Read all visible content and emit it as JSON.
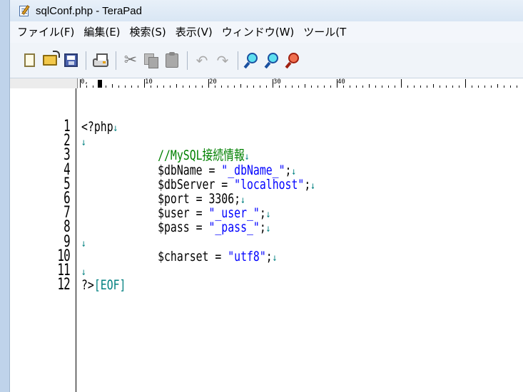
{
  "window": {
    "title": "sqlConf.php - TeraPad",
    "icon": "terapad-app-icon"
  },
  "menu": {
    "items": [
      "ファイル(F)",
      "編集(E)",
      "検索(S)",
      "表示(V)",
      "ウィンドウ(W)",
      "ツール(T"
    ]
  },
  "toolbar": {
    "icons": [
      "new-file-icon",
      "open-file-icon",
      "save-icon",
      "print-icon",
      "cut-icon",
      "copy-icon",
      "paste-icon",
      "undo-icon",
      "redo-icon",
      "find-icon",
      "find-prev-icon",
      "find-next-icon"
    ]
  },
  "ruler": {
    "labels": [
      "0,",
      "10",
      "20",
      "30",
      "40"
    ]
  },
  "editor": {
    "newline_mark": "↓",
    "lines": [
      {
        "no": "1",
        "indent": "",
        "parts": [
          {
            "t": "<?php",
            "c": "plain"
          }
        ],
        "nl": true
      },
      {
        "no": "2",
        "indent": "",
        "parts": [],
        "nl": true
      },
      {
        "no": "3",
        "indent": "            ",
        "parts": [
          {
            "t": "//MySQL接続情報",
            "c": "comment"
          }
        ],
        "nl": true
      },
      {
        "no": "4",
        "indent": "            ",
        "parts": [
          {
            "t": "$dbName = ",
            "c": "plain"
          },
          {
            "t": "\"_dbName_\"",
            "c": "string"
          },
          {
            "t": ";",
            "c": "plain"
          }
        ],
        "nl": true
      },
      {
        "no": "5",
        "indent": "            ",
        "parts": [
          {
            "t": "$dbServer = ",
            "c": "plain"
          },
          {
            "t": "\"localhost\"",
            "c": "string"
          },
          {
            "t": ";",
            "c": "plain"
          }
        ],
        "nl": true
      },
      {
        "no": "6",
        "indent": "            ",
        "parts": [
          {
            "t": "$port = 3306;",
            "c": "plain"
          }
        ],
        "nl": true
      },
      {
        "no": "7",
        "indent": "            ",
        "parts": [
          {
            "t": "$user = ",
            "c": "plain"
          },
          {
            "t": "\"_user_\"",
            "c": "string"
          },
          {
            "t": ";",
            "c": "plain"
          }
        ],
        "nl": true
      },
      {
        "no": "8",
        "indent": "            ",
        "parts": [
          {
            "t": "$pass = ",
            "c": "plain"
          },
          {
            "t": "\"_pass_\"",
            "c": "string"
          },
          {
            "t": ";",
            "c": "plain"
          }
        ],
        "nl": true
      },
      {
        "no": "9",
        "indent": "",
        "parts": [],
        "nl": true
      },
      {
        "no": "10",
        "indent": "            ",
        "parts": [
          {
            "t": "$charset = ",
            "c": "plain"
          },
          {
            "t": "\"utf8\"",
            "c": "string"
          },
          {
            "t": ";",
            "c": "plain"
          }
        ],
        "nl": true
      },
      {
        "no": "11",
        "indent": "",
        "parts": [],
        "nl": true
      },
      {
        "no": "12",
        "indent": "",
        "parts": [
          {
            "t": "?>",
            "c": "plain"
          },
          {
            "t": "[EOF]",
            "c": "eof"
          }
        ],
        "nl": false
      }
    ]
  },
  "colors": {
    "comment": "#008000",
    "string": "#0000ff",
    "eof": "#008080",
    "newline": "#008080"
  }
}
